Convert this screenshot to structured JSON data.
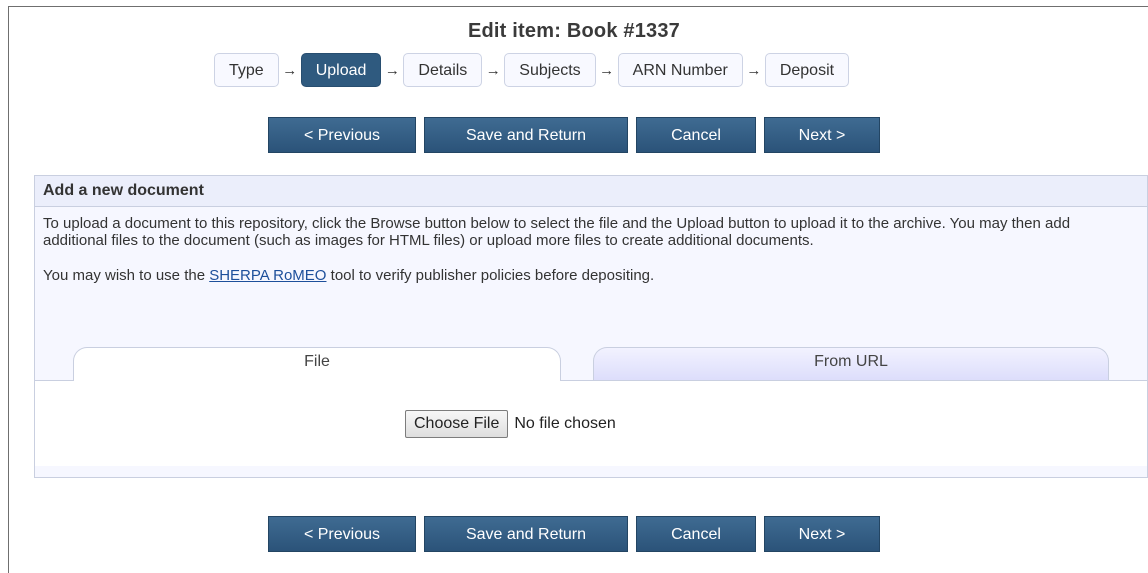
{
  "page": {
    "title": "Edit item: Book #1337"
  },
  "workflow": {
    "steps": [
      {
        "label": "Type",
        "current": false
      },
      {
        "label": "Upload",
        "current": true
      },
      {
        "label": "Details",
        "current": false
      },
      {
        "label": "Subjects",
        "current": false
      },
      {
        "label": "ARN Number",
        "current": false
      },
      {
        "label": "Deposit",
        "current": false
      }
    ],
    "arrow_glyph": "→"
  },
  "buttons": {
    "previous": "< Previous",
    "save_return": "Save and Return",
    "cancel": "Cancel",
    "next": "Next >"
  },
  "upload_panel": {
    "heading": "Add a new document",
    "instructions": "To upload a document to this repository, click the Browse button below to select the file and the Upload button to upload it to the archive. You may then add additional files to the document (such as images for HTML files) or upload more files to create additional documents.",
    "note_before": "You may wish to use the ",
    "note_link": "SHERPA RoMEO",
    "note_after": " tool to verify publisher policies before depositing.",
    "tabs": [
      {
        "label": "File",
        "active": true
      },
      {
        "label": "From URL",
        "active": false
      }
    ],
    "file_button": "Choose File",
    "file_status": "No file chosen"
  },
  "colors": {
    "step_current": "#2f5a7f",
    "button": "#2b5379",
    "panel_bg": "#f6f7ff",
    "link": "#1d4f9b"
  }
}
